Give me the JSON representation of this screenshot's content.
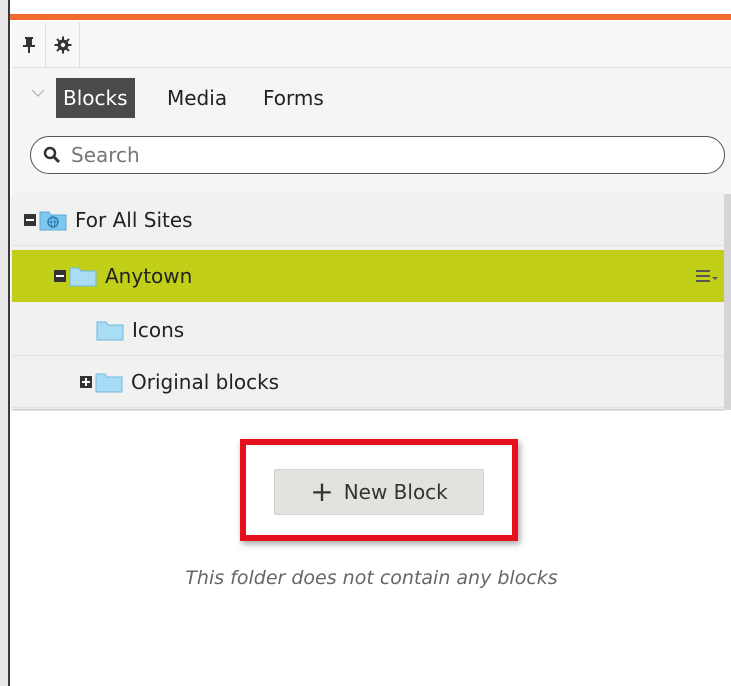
{
  "tabs": [
    {
      "label": "Blocks"
    },
    {
      "label": "Media"
    },
    {
      "label": "Forms"
    }
  ],
  "search": {
    "placeholder": "Search",
    "value": ""
  },
  "tree": {
    "items": [
      {
        "label": "For All Sites"
      },
      {
        "label": "Anytown"
      },
      {
        "label": "Icons"
      },
      {
        "label": "Original blocks"
      }
    ]
  },
  "content": {
    "new_block_label": "New Block",
    "empty_message": "This folder does not contain any blocks"
  },
  "colors": {
    "accent_orange": "#f26a2e",
    "selected_row": "#c2cf18",
    "highlight_red": "#e4101b",
    "folder_blue": "#7ec8ee"
  },
  "icons": [
    "pin-icon",
    "gear-icon",
    "chevron-down-icon",
    "search-icon",
    "folder-icon",
    "globe-folder-icon",
    "menu-icon",
    "plus-icon"
  ]
}
